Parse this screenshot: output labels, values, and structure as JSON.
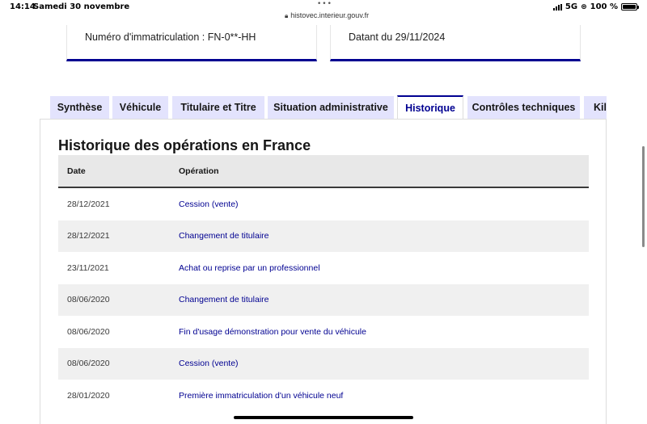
{
  "status_bar": {
    "time": "14:14",
    "date": "Samedi 30 novembre",
    "url": "histovec.interieur.gouv.fr",
    "network": "5G",
    "battery": "100 %",
    "battery_level": 1.0
  },
  "cards": {
    "plate": "Numéro d'immatriculation : FN-0**-HH",
    "date": "Datant du 29/11/2024"
  },
  "tabs": [
    {
      "label": "Synthèse"
    },
    {
      "label": "Véhicule"
    },
    {
      "label": "Titulaire et Titre"
    },
    {
      "label": "Situation administrative"
    },
    {
      "label": "Historique",
      "active": true
    },
    {
      "label": "Contrôles techniques"
    },
    {
      "label": "Kilo"
    }
  ],
  "history": {
    "title": "Historique des opérations en France",
    "columns": {
      "date": "Date",
      "operation": "Opération"
    },
    "rows": [
      {
        "date": "28/12/2021",
        "operation": "Cession (vente)"
      },
      {
        "date": "28/12/2021",
        "operation": "Changement de titulaire"
      },
      {
        "date": "23/11/2021",
        "operation": "Achat ou reprise par un professionnel"
      },
      {
        "date": "08/06/2020",
        "operation": "Changement de titulaire"
      },
      {
        "date": "08/06/2020",
        "operation": "Fin d'usage démonstration pour vente du véhicule"
      },
      {
        "date": "08/06/2020",
        "operation": "Cession (vente)"
      },
      {
        "date": "28/01/2020",
        "operation": "Première immatriculation d'un véhicule neuf"
      }
    ]
  },
  "colors": {
    "primary": "#000091",
    "tab_bg": "#e3e3fd",
    "row_alt": "#f0f0f0"
  }
}
